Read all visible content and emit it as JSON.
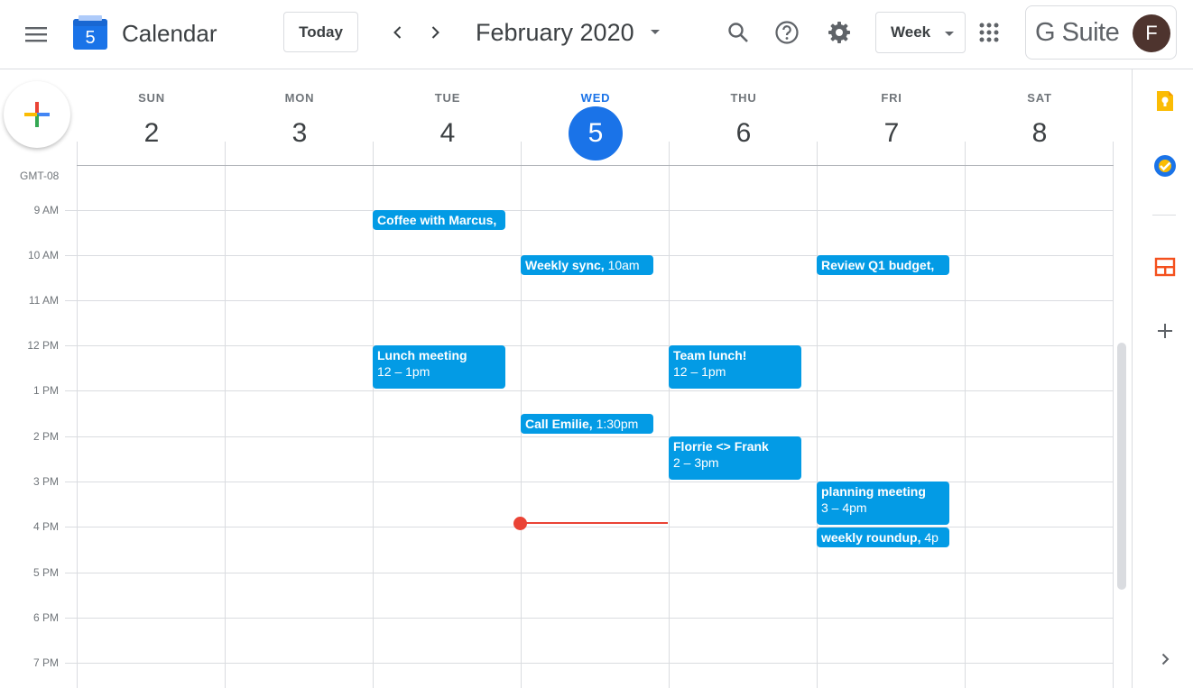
{
  "header": {
    "app_title": "Calendar",
    "logo_day": "5",
    "today_label": "Today",
    "month_label": "February 2020",
    "view_label": "Week",
    "brand": "G Suite",
    "avatar_initial": "F"
  },
  "week": {
    "days": [
      {
        "name": "SUN",
        "num": "2"
      },
      {
        "name": "MON",
        "num": "3"
      },
      {
        "name": "TUE",
        "num": "4"
      },
      {
        "name": "WED",
        "num": "5"
      },
      {
        "name": "THU",
        "num": "6"
      },
      {
        "name": "FRI",
        "num": "7"
      },
      {
        "name": "SAT",
        "num": "8"
      }
    ],
    "today_index": 3
  },
  "grid": {
    "timezone": "GMT-08",
    "hours": [
      "9 AM",
      "10 AM",
      "11 AM",
      "12 PM",
      "1 PM",
      "2 PM",
      "3 PM",
      "4 PM",
      "5 PM",
      "6 PM",
      "7 PM"
    ]
  },
  "events": [
    {
      "title": "Coffee with Marcus,",
      "time": ""
    },
    {
      "title": "Weekly sync,",
      "time": " 10am"
    },
    {
      "title": "Review Q1 budget,",
      "time": ""
    },
    {
      "title": "Lunch meeting",
      "time": "12 – 1pm"
    },
    {
      "title": "Team lunch!",
      "time": "12 – 1pm"
    },
    {
      "title": "Call Emilie,",
      "time": " 1:30pm"
    },
    {
      "title": "Florrie <> Frank",
      "time": "2 – 3pm"
    },
    {
      "title": "planning meeting",
      "time": "3 – 4pm"
    },
    {
      "title": "weekly roundup,",
      "time": " 4p"
    }
  ],
  "icons": {
    "menu": "menu-icon",
    "search": "search-icon",
    "help": "help-icon",
    "settings": "gear-icon",
    "apps": "apps-grid-icon",
    "keep": "keep-icon",
    "tasks": "tasks-icon",
    "addons": "add-icon"
  },
  "colors": {
    "event": "#039be5",
    "today": "#1a73e8",
    "now_line": "#ea4335"
  }
}
